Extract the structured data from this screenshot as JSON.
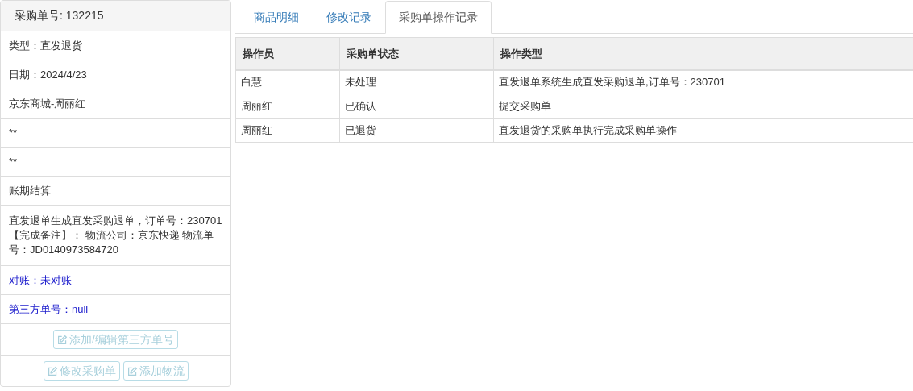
{
  "panel": {
    "title": "采购单号: 132215",
    "items": [
      {
        "text": "类型：直发退货",
        "kind": "plain"
      },
      {
        "text": "日期：2024/4/23",
        "kind": "plain"
      },
      {
        "text": "京东商城-周丽红",
        "kind": "plain"
      },
      {
        "text": "**",
        "kind": "plain"
      },
      {
        "text": "**",
        "kind": "plain"
      },
      {
        "text": "账期结算",
        "kind": "plain"
      },
      {
        "text": "直发退单生成直发采购退单，订单号：230701【完成备注】： 物流公司：京东快递 物流单号：JD0140973584720",
        "kind": "plain"
      },
      {
        "text": "对账：未对账",
        "kind": "accent"
      },
      {
        "text": "第三方单号：null",
        "kind": "accent"
      }
    ],
    "button_rows": [
      [
        {
          "label": "添加/编辑第三方单号",
          "disabled": true
        }
      ],
      [
        {
          "label": "修改采购单",
          "disabled": true
        },
        {
          "label": "添加物流",
          "disabled": true
        }
      ]
    ]
  },
  "tabs": [
    {
      "label": "商品明细",
      "selected": false
    },
    {
      "label": "修改记录",
      "selected": false
    },
    {
      "label": "采购单操作记录",
      "selected": true
    }
  ],
  "table": {
    "columns": [
      "操作员",
      "采购单状态",
      "操作类型"
    ],
    "rows": [
      [
        "白慧",
        "未处理",
        "直发退单系统生成直发采购退单,订单号：230701"
      ],
      [
        "周丽红",
        "已确认",
        "提交采购单"
      ],
      [
        "周丽红",
        "已退货",
        "直发退货的采购单执行完成采购单操作"
      ]
    ]
  }
}
